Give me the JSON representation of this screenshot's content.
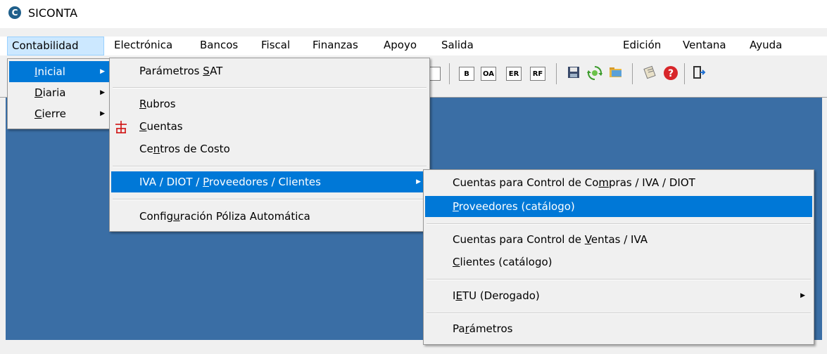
{
  "window": {
    "title": "SICONTA"
  },
  "menubar": {
    "items": [
      "Contabilidad",
      "Electrónica",
      "Bancos",
      "Fiscal",
      "Finanzas",
      "Apoyo",
      "Salida",
      "Edición",
      "Ventana",
      "Ayuda"
    ]
  },
  "toolbar": {
    "text_buttons": [
      "B",
      "OA",
      "ER",
      "RF"
    ],
    "icons": [
      "save-icon",
      "refresh-icon",
      "open-folder-icon",
      "notepad-icon",
      "help-icon",
      "exit-door-icon"
    ]
  },
  "menu_contabilidad": {
    "items": [
      {
        "label": "Inicial",
        "accel": "I",
        "rest": "nicial",
        "submenu": true,
        "selected": true
      },
      {
        "label": "Diaria",
        "accel": "D",
        "rest": "iaria",
        "submenu": true
      },
      {
        "label": "Cierre",
        "accel": "C",
        "rest": "ierre",
        "submenu": true
      }
    ]
  },
  "menu_inicial": {
    "parametros_sat": {
      "pre": "Parámetros ",
      "accel": "S",
      "post": "AT"
    },
    "rubros": {
      "pre": "",
      "accel": "R",
      "post": "ubros"
    },
    "cuentas": {
      "pre": "",
      "accel": "C",
      "post": "uentas",
      "icon": "org-chart-icon"
    },
    "centros": {
      "pre": "Ce",
      "accel": "n",
      "post": "tros de Costo"
    },
    "iva_diot": {
      "pre": "IVA / DIOT / ",
      "accel": "P",
      "post": "roveedores / Clientes",
      "selected": true
    },
    "config_poliza": {
      "pre": "Config",
      "accel": "u",
      "post": "ración Póliza Automática"
    }
  },
  "menu_iva": {
    "cuentas_compras": {
      "pre": "Cuentas para Control de Co",
      "accel": "m",
      "post": "pras / IVA / DIOT"
    },
    "proveedores": {
      "pre": "",
      "accel": "P",
      "post": "roveedores (catálogo)",
      "selected": true
    },
    "cuentas_ventas": {
      "pre": "Cuentas para Control de ",
      "accel": "V",
      "post": "entas / IVA"
    },
    "clientes": {
      "pre": "",
      "accel": "C",
      "post": "lientes (catálogo)"
    },
    "ietu": {
      "pre": "I",
      "accel": "E",
      "post": "TU (Derogado)"
    },
    "parametros": {
      "pre": "Pa",
      "accel": "r",
      "post": "ámetros"
    }
  }
}
